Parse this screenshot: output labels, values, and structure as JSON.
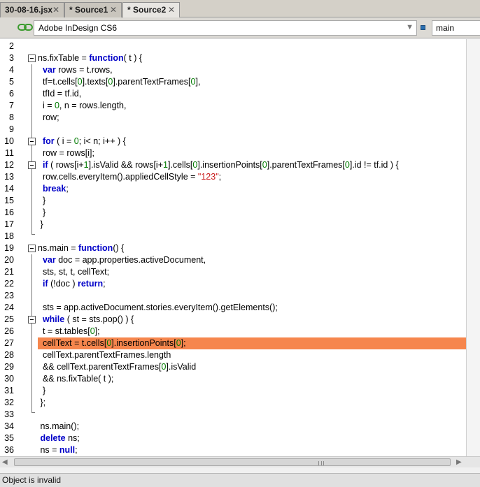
{
  "tabs": [
    {
      "label": "30-08-16.jsx",
      "active": false
    },
    {
      "label": "* Source1",
      "active": false
    },
    {
      "label": "* Source2",
      "active": true
    }
  ],
  "toolbar": {
    "target_app": "Adobe InDesign CS6",
    "engine": "main",
    "link_icon": "chain-link-icon",
    "stop_icon": "stop-icon"
  },
  "editor": {
    "highlight_color": "#f6864d",
    "highlighted_line": 27,
    "lines": [
      {
        "n": "2",
        "tokens": []
      },
      {
        "n": "3",
        "tokens": [
          [
            "t",
            "ns.fixTable = "
          ],
          [
            "k",
            "function"
          ],
          [
            "t",
            "( t ) {"
          ]
        ]
      },
      {
        "n": "4",
        "tokens": [
          [
            "t",
            "  "
          ],
          [
            "k",
            "var"
          ],
          [
            "t",
            " rows = t.rows,"
          ]
        ]
      },
      {
        "n": "5",
        "tokens": [
          [
            "t",
            "  tf=t.cells["
          ],
          [
            "n",
            "0"
          ],
          [
            "t",
            "].texts["
          ],
          [
            "n",
            "0"
          ],
          [
            "t",
            "].parentTextFrames["
          ],
          [
            "n",
            "0"
          ],
          [
            "t",
            "],"
          ]
        ]
      },
      {
        "n": "6",
        "tokens": [
          [
            "t",
            "  tfId = tf.id,"
          ]
        ]
      },
      {
        "n": "7",
        "tokens": [
          [
            "t",
            "  i = "
          ],
          [
            "n",
            "0"
          ],
          [
            "t",
            ", n = rows.length,"
          ]
        ]
      },
      {
        "n": "8",
        "tokens": [
          [
            "t",
            "  row;"
          ]
        ]
      },
      {
        "n": "9",
        "tokens": []
      },
      {
        "n": "10",
        "tokens": [
          [
            "t",
            "  "
          ],
          [
            "k",
            "for"
          ],
          [
            "t",
            " ( i = "
          ],
          [
            "n",
            "0"
          ],
          [
            "t",
            "; i< n; i++ ) {"
          ]
        ]
      },
      {
        "n": "11",
        "tokens": [
          [
            "t",
            "  row = rows[i];"
          ]
        ]
      },
      {
        "n": "12",
        "tokens": [
          [
            "t",
            "  "
          ],
          [
            "k",
            "if"
          ],
          [
            "t",
            " ( rows[i+"
          ],
          [
            "n",
            "1"
          ],
          [
            "t",
            "].isValid && rows[i+"
          ],
          [
            "n",
            "1"
          ],
          [
            "t",
            "].cells["
          ],
          [
            "n",
            "0"
          ],
          [
            "t",
            "].insertionPoints["
          ],
          [
            "n",
            "0"
          ],
          [
            "t",
            "].parentTextFrames["
          ],
          [
            "n",
            "0"
          ],
          [
            "t",
            "].id != tf.id ) {"
          ]
        ]
      },
      {
        "n": "13",
        "tokens": [
          [
            "t",
            "  row.cells.everyItem().appliedCellStyle = "
          ],
          [
            "s",
            "\"123\""
          ],
          [
            "t",
            ";"
          ]
        ]
      },
      {
        "n": "14",
        "tokens": [
          [
            "t",
            "  "
          ],
          [
            "k",
            "break"
          ],
          [
            "t",
            ";"
          ]
        ]
      },
      {
        "n": "15",
        "tokens": [
          [
            "t",
            "  }"
          ]
        ]
      },
      {
        "n": "16",
        "tokens": [
          [
            "t",
            "  }"
          ]
        ]
      },
      {
        "n": "17",
        "tokens": [
          [
            "t",
            " }"
          ]
        ]
      },
      {
        "n": "18",
        "tokens": []
      },
      {
        "n": "19",
        "tokens": [
          [
            "t",
            "ns.main = "
          ],
          [
            "k",
            "function"
          ],
          [
            "t",
            "() {"
          ]
        ]
      },
      {
        "n": "20",
        "tokens": [
          [
            "t",
            "  "
          ],
          [
            "k",
            "var"
          ],
          [
            "t",
            " doc = app.properties.activeDocument,"
          ]
        ]
      },
      {
        "n": "21",
        "tokens": [
          [
            "t",
            "  sts, st, t, cellText;"
          ]
        ]
      },
      {
        "n": "22",
        "tokens": [
          [
            "t",
            "  "
          ],
          [
            "k",
            "if"
          ],
          [
            "t",
            " (!doc ) "
          ],
          [
            "k",
            "return"
          ],
          [
            "t",
            ";"
          ]
        ]
      },
      {
        "n": "23",
        "tokens": []
      },
      {
        "n": "24",
        "tokens": [
          [
            "t",
            "  sts = app.activeDocument.stories.everyItem().getElements();"
          ]
        ]
      },
      {
        "n": "25",
        "tokens": [
          [
            "t",
            "  "
          ],
          [
            "k",
            "while"
          ],
          [
            "t",
            " ( st = sts.pop() ) {"
          ]
        ]
      },
      {
        "n": "26",
        "tokens": [
          [
            "t",
            "  t = st.tables["
          ],
          [
            "n",
            "0"
          ],
          [
            "t",
            "];"
          ]
        ]
      },
      {
        "n": "27",
        "tokens": [
          [
            "t",
            "  cellText = t.cells["
          ],
          [
            "n",
            "0"
          ],
          [
            "t",
            "].insertionPoints["
          ],
          [
            "n",
            "0"
          ],
          [
            "t",
            "];"
          ]
        ]
      },
      {
        "n": "28",
        "tokens": [
          [
            "t",
            "  cellText.parentTextFrames.length"
          ]
        ]
      },
      {
        "n": "29",
        "tokens": [
          [
            "t",
            "  && cellText.parentTextFrames["
          ],
          [
            "n",
            "0"
          ],
          [
            "t",
            "].isValid"
          ]
        ]
      },
      {
        "n": "30",
        "tokens": [
          [
            "t",
            "  && ns.fixTable( t );"
          ]
        ]
      },
      {
        "n": "31",
        "tokens": [
          [
            "t",
            "  }"
          ]
        ]
      },
      {
        "n": "32",
        "tokens": [
          [
            "t",
            " };"
          ]
        ]
      },
      {
        "n": "33",
        "tokens": []
      },
      {
        "n": "34",
        "tokens": [
          [
            "t",
            " ns.main();"
          ]
        ]
      },
      {
        "n": "35",
        "tokens": [
          [
            "t",
            " "
          ],
          [
            "k",
            "delete"
          ],
          [
            "t",
            " ns;"
          ]
        ]
      },
      {
        "n": "36",
        "tokens": [
          [
            "t",
            " ns = "
          ],
          [
            "k",
            "null"
          ],
          [
            "t",
            ";"
          ]
        ]
      }
    ]
  },
  "status": {
    "message": "Object is invalid"
  }
}
